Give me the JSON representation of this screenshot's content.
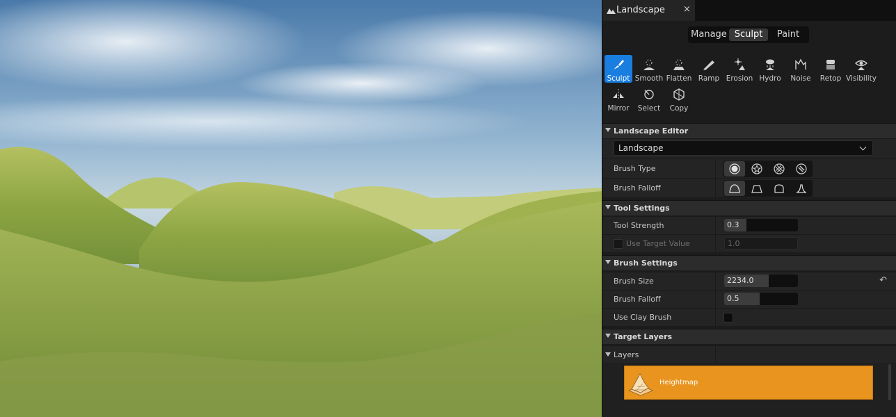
{
  "tab": {
    "title": "Landscape",
    "close_glyph": "×"
  },
  "modes": [
    {
      "label": "Manage",
      "active": false
    },
    {
      "label": "Sculpt",
      "active": true
    },
    {
      "label": "Paint",
      "active": false
    }
  ],
  "tools": [
    {
      "label": "Sculpt",
      "icon": "sculpt-icon",
      "active": true
    },
    {
      "label": "Smooth",
      "icon": "smooth-icon"
    },
    {
      "label": "Flatten",
      "icon": "flatten-icon"
    },
    {
      "label": "Ramp",
      "icon": "ramp-icon"
    },
    {
      "label": "Erosion",
      "icon": "erosion-icon"
    },
    {
      "label": "Hydro",
      "icon": "hydro-icon"
    },
    {
      "label": "Noise",
      "icon": "noise-icon"
    },
    {
      "label": "Retop",
      "icon": "retop-icon"
    },
    {
      "label": "Visibility",
      "icon": "visibility-icon"
    },
    {
      "label": "Mirror",
      "icon": "mirror-icon"
    },
    {
      "label": "Select",
      "icon": "select-icon"
    },
    {
      "label": "Copy",
      "icon": "copy-icon"
    }
  ],
  "sections": {
    "landscape_editor": "Landscape Editor",
    "tool_settings": "Tool Settings",
    "brush_settings": "Brush Settings",
    "target_layers": "Target Layers"
  },
  "landscape_select": {
    "value": "Landscape"
  },
  "brush_type": {
    "label": "Brush Type",
    "selected_index": 0
  },
  "brush_falloff_type": {
    "label": "Brush Falloff",
    "selected_index": 0
  },
  "tool_strength": {
    "label": "Tool Strength",
    "value": "0.3",
    "fraction": 0.3
  },
  "use_target_value": {
    "label": "Use Target Value",
    "value": "1.0",
    "enabled": false
  },
  "brush_size": {
    "label": "Brush Size",
    "value": "2234.0",
    "fraction": 0.6
  },
  "brush_falloff": {
    "label": "Brush Falloff",
    "value": "0.5",
    "fraction": 0.48
  },
  "use_clay_brush": {
    "label": "Use Clay Brush",
    "checked": false
  },
  "layers": {
    "label": "Layers",
    "items": [
      {
        "name": "Heightmap",
        "selected": true
      }
    ]
  },
  "colors": {
    "accent_blue": "#1a7de0",
    "layer_orange": "#e8941f"
  }
}
